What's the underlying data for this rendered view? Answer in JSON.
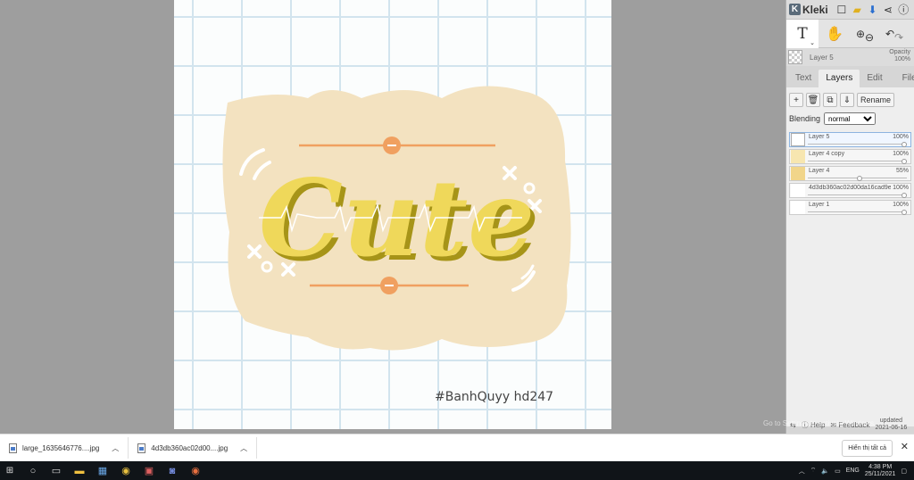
{
  "app": {
    "name": "Kleki"
  },
  "artwork": {
    "text": "Cute",
    "watermark": "#BanhQuyy   hd247",
    "colors": {
      "blob": "#f3e2c0",
      "accent": "#f0a060",
      "text_fill": "#efd85a",
      "text_shadow": "#a69418"
    }
  },
  "toolbar": {
    "tool_active": "T",
    "tool_hand": "✋",
    "zoom_in": "⊕",
    "zoom_out": "⊖",
    "undo": "↶",
    "redo": "↷"
  },
  "current_layer": {
    "name": "Layer 5",
    "opacity_label": "Opacity",
    "opacity_value": "100%"
  },
  "tabs": [
    {
      "label": "Text"
    },
    {
      "label": "Layers"
    },
    {
      "label": "Edit"
    },
    {
      "label": "File"
    }
  ],
  "layer_actions": {
    "add": "+",
    "delete": "🗑",
    "duplicate": "⧉",
    "merge": "⇓",
    "rename": "Rename"
  },
  "blending": {
    "label": "Blending",
    "value": "normal"
  },
  "layers": [
    {
      "name": "Layer 5",
      "opacity": "100%",
      "level": 1.0
    },
    {
      "name": "Layer 4 copy",
      "opacity": "100%",
      "level": 1.0
    },
    {
      "name": "Layer 4",
      "opacity": "55%",
      "level": 0.55
    },
    {
      "name": "4d3db360ac02d00da16cad9e",
      "opacity": "100%",
      "level": 1.0
    },
    {
      "name": "Layer 1",
      "opacity": "100%",
      "level": 1.0
    }
  ],
  "footer": {
    "help": "Help",
    "feedback": "Feedback",
    "updated": "updated",
    "date": "2021-06-16"
  },
  "activate_text": "Go to Settings to activate Windows.",
  "downloads": [
    {
      "name": "large_1635646776....jpg"
    },
    {
      "name": "4d3db360ac02d00....jpg"
    }
  ],
  "downloads_show_all": "Hiển thị tất cả",
  "taskbar": {
    "lang": "ENG",
    "time": "4:38 PM",
    "date": "25/11/2021"
  }
}
